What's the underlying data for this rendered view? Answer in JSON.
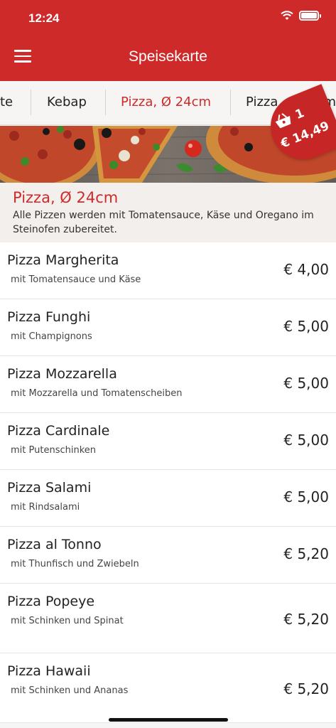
{
  "status_bar": {
    "time": "12:24"
  },
  "header": {
    "title": "Speisekarte"
  },
  "tabs": [
    {
      "label": "te"
    },
    {
      "label": "Kebap"
    },
    {
      "label": "Pizza, Ø 24cm"
    },
    {
      "label": "Pizza, Ø 30cm"
    }
  ],
  "active_tab": "Pizza, Ø 24cm",
  "cart": {
    "count": "1",
    "total": "€ 14,49"
  },
  "category": {
    "title": "Pizza, Ø 24cm",
    "description": "Alle Pizzen werden mit Tomatensauce, Käse und Oregano im Steinofen zubereitet."
  },
  "items": [
    {
      "name": "Pizza Margherita",
      "description": "mit Tomatensauce und Käse",
      "price": "€ 4,00"
    },
    {
      "name": "Pizza Funghi",
      "description": "mit Champignons",
      "price": "€ 5,00"
    },
    {
      "name": "Pizza Mozzarella",
      "description": "mit Mozzarella und Tomatenscheiben",
      "price": "€ 5,00"
    },
    {
      "name": "Pizza Cardinale",
      "description": "mit Putenschinken",
      "price": "€ 5,00"
    },
    {
      "name": "Pizza Salami",
      "description": "mit Rindsalami",
      "price": "€ 5,00"
    },
    {
      "name": "Pizza al Tonno",
      "description": "mit Thunfisch und Zwiebeln",
      "price": "€ 5,20"
    },
    {
      "name": "Pizza Popeye",
      "description": "mit Schinken und Spinat",
      "price": "€ 5,20"
    },
    {
      "name": "Pizza Hawaii",
      "description": "mit Schinken und Ananas",
      "price": "€ 5,20"
    }
  ],
  "colors": {
    "brand_red": "#cf2a2a",
    "background": "#f6f5f3"
  }
}
